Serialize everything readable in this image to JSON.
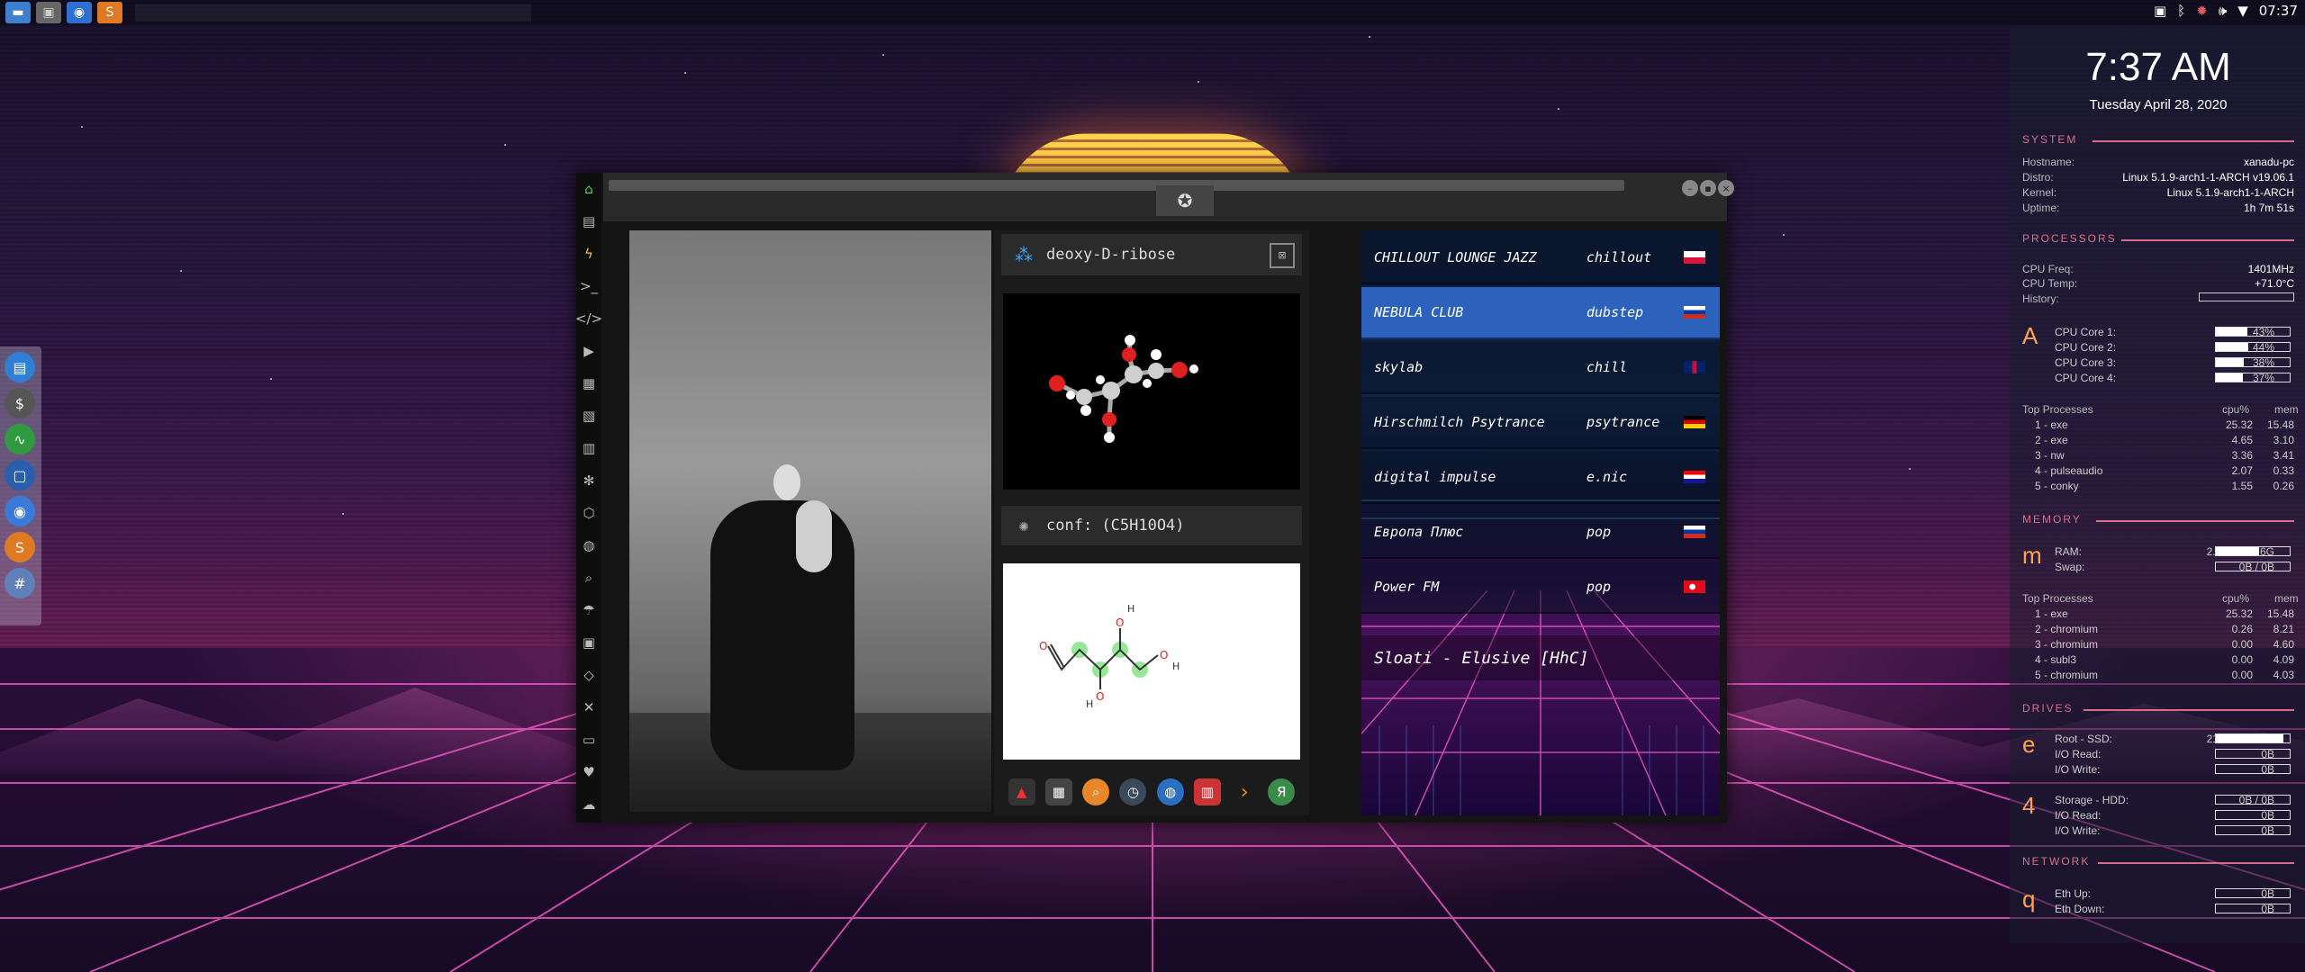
{
  "topbar": {
    "launcher": [
      {
        "icon": "folder-icon",
        "color": "#4a90d9"
      },
      {
        "icon": "window-icon",
        "color": "#888888"
      },
      {
        "icon": "chromium-icon",
        "color": "#3b7ad9"
      },
      {
        "icon": "sublime-icon",
        "color": "#f18b2a"
      }
    ],
    "tray_icons": [
      "screenshot-icon",
      "bluetooth-icon",
      "settings-icon",
      "volume-icon",
      "wifi-icon"
    ],
    "time": "07:37"
  },
  "conky": {
    "clock": "7:37 AM",
    "date": "Tuesday April 28, 2020",
    "system": {
      "title": "SYSTEM",
      "rows": [
        {
          "k": "Hostname:",
          "v": "xanadu-pc"
        },
        {
          "k": "Distro:",
          "v": "Linux 5.1.9-arch1-1-ARCH v19.06.1"
        },
        {
          "k": "Kernel:",
          "v": "Linux 5.1.9-arch1-1-ARCH"
        },
        {
          "k": "Uptime:",
          "v": "1h 7m 51s"
        }
      ]
    },
    "processors": {
      "title": "PROCESSORS",
      "freq_label": "CPU Freq:",
      "freq": "1401MHz",
      "temp_label": "CPU Temp:",
      "temp": "+71.0°C",
      "history_label": "History:",
      "letter": "A",
      "cores": [
        {
          "label": "CPU Core 1:",
          "value": "43%",
          "pct": 0.43
        },
        {
          "label": "CPU Core 2:",
          "value": "44%",
          "pct": 0.44
        },
        {
          "label": "CPU Core 3:",
          "value": "38%",
          "pct": 0.38
        },
        {
          "label": "CPU Core 4:",
          "value": "37%",
          "pct": 0.37
        }
      ],
      "top_title": "Top Processes",
      "col1": "cpu%",
      "col2": "mem",
      "top": [
        {
          "name": "1 - exe",
          "cpu": "25.32",
          "mem": "15.48"
        },
        {
          "name": "2 - exe",
          "cpu": "4.65",
          "mem": "3.10"
        },
        {
          "name": "3 - nw",
          "cpu": "3.36",
          "mem": "3.41"
        },
        {
          "name": "4 - pulseaudio",
          "cpu": "2.07",
          "mem": "0.33"
        },
        {
          "name": "5 - conky",
          "cpu": "1.55",
          "mem": "0.26"
        }
      ]
    },
    "memory": {
      "title": "MEMORY",
      "letter": "m",
      "ram_label": "RAM:",
      "ram": "2.22G / 3.76G",
      "ram_pct": 0.59,
      "swap_label": "Swap:",
      "swap": "0B / 0B",
      "swap_pct": 0,
      "top_title": "Top Processes",
      "col1": "cpu%",
      "col2": "mem",
      "top": [
        {
          "name": "1 - exe",
          "cpu": "25.32",
          "mem": "15.48"
        },
        {
          "name": "2 - chromium",
          "cpu": "0.26",
          "mem": "8.21"
        },
        {
          "name": "3 - chromium",
          "cpu": "0.00",
          "mem": "4.60"
        },
        {
          "name": "4 - subl3",
          "cpu": "0.00",
          "mem": "4.09"
        },
        {
          "name": "5 - chromium",
          "cpu": "0.00",
          "mem": "4.03"
        }
      ]
    },
    "drives": {
      "title": "DRIVES",
      "letter1": "e",
      "root_label": "Root - SSD:",
      "root": "21.8G / 23.9G",
      "root_pct": 0.91,
      "io_read_label": "I/O Read:",
      "io_read": "0B",
      "io_write_label": "I/O Write:",
      "io_write": "0B",
      "letter2": "4",
      "storage_label": "Storage - HDD:",
      "storage": "0B / 0B",
      "io_read2": "0B",
      "io_write2": "0B"
    },
    "network": {
      "title": "NETWORK",
      "letter": "q",
      "up_label": "Eth Up:",
      "up": "0B",
      "down_label": "Eth Down:",
      "down": "0B"
    }
  },
  "left_dock": [
    "files-icon",
    "money-icon",
    "monitor-icon",
    "screen-icon",
    "chromium-icon",
    "sublime-icon",
    "grid-icon"
  ],
  "window": {
    "sidebar_icons": [
      "home-icon",
      "document-icon",
      "bolt-icon",
      "terminal-icon",
      "code-icon",
      "play-icon",
      "gallery-icon",
      "image-icon",
      "news-icon",
      "snowflake-icon",
      "hexagon-icon",
      "globe-icon",
      "search-icon",
      "umbrella-icon",
      "contact-icon",
      "tag-icon",
      "expand-icon",
      "youtube-icon",
      "heart-icon",
      "cloud-icon"
    ],
    "molecule": {
      "name": "deoxy-D-ribose",
      "conf": "conf: (C5H10O4)"
    },
    "mini_dock": [
      "arch-icon",
      "calendar-icon",
      "search-icon",
      "clock-icon",
      "globe-icon",
      "calendar-alt-icon",
      "arrow-icon",
      "yandex-icon"
    ],
    "stations": [
      {
        "name": "CHILLOUT LOUNGE JAZZ",
        "genre": "chillout",
        "flag": "poland",
        "active": false
      },
      {
        "name": "NEBULA CLUB",
        "genre": "dubstep",
        "flag": "russia",
        "active": true
      },
      {
        "name": "skylab",
        "genre": "chill",
        "flag": "uk",
        "active": false
      },
      {
        "name": "Hirschmilch Psytrance",
        "genre": "psytrance",
        "flag": "germany",
        "active": false
      },
      {
        "name": "digital impulse",
        "genre": "e.nic",
        "flag": "croatia",
        "active": false
      },
      {
        "name": "Европа Плюс",
        "genre": "pop",
        "flag": "russia",
        "active": false
      },
      {
        "name": "Power FM",
        "genre": "pop",
        "flag": "turkey",
        "active": false
      }
    ],
    "now_playing": "Sloati - Elusive [HhC]"
  }
}
